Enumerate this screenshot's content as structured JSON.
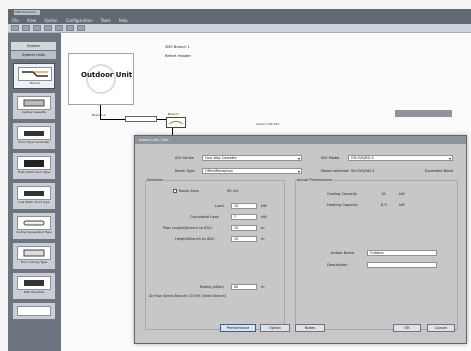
{
  "window": {
    "title": "SMS Selection"
  },
  "menu": [
    "File",
    "View",
    "Option",
    "Configuration",
    "Tools",
    "Help"
  ],
  "sidebar": {
    "header": "System",
    "header2": "System Units",
    "items": [
      {
        "label": "Branch"
      },
      {
        "label": "Ceiling Cassette"
      },
      {
        "label": "Floor Type Controller"
      },
      {
        "label": "High Static Duct Type"
      },
      {
        "label": "Low Static Duct Type"
      },
      {
        "label": "Ceiling Suspended Type"
      },
      {
        "label": "Floor Ceiling Type"
      },
      {
        "label": "Wall Mounted"
      }
    ]
  },
  "canvas": {
    "outdoor_unit": "Outdoor Unit",
    "top_label": "SMS Branch 1",
    "top_label2": "Refnet Header",
    "branch_a": "Branch A",
    "branch_b": "Branch",
    "note": "Indoor Unit Info"
  },
  "dialog": {
    "title": "Indoor Unit / Info",
    "idu_series_label": "IDU Series",
    "idu_series_value": "Four Way Cassette",
    "idu_model_label": "IDU Model",
    "idu_model_value": "GH-0VS/RD-3",
    "room_type_label": "Room Type",
    "room_type_value": "Office/Reception",
    "model_selected_label": "Model selected: GH-0VS/RD-3",
    "selected_check": "Exceeded Need",
    "selection_group": "Selection",
    "room_area_label": "Room Area",
    "room_area_value": "90 m2",
    "load_label": "Load",
    "load_value": "10",
    "load_unit": "kW",
    "calc_load_label": "Calculated Load",
    "calc_load_value": "7",
    "calc_load_unit": "kW",
    "pipe_length_label": "Pipe Length(Branch to IDU)",
    "pipe_length_value": "10",
    "pipe_length_unit": "m",
    "height_label": "Height(Branch to IDU)",
    "height_value": "10",
    "height_unit": "m",
    "actual_perf_group": "Actual Performance",
    "cooling_label": "Cooling Capacity",
    "cooling_value": "16",
    "cooling_unit": "kW",
    "heating_label": "Heating Capacity",
    "heating_value": "8.9",
    "heating_unit": "kW",
    "rating_label": "Rating (kBtu)",
    "rating_value": "60",
    "rating_unit": "m",
    "airflow_label": "Air Flow (Select Branch): (0.5/H) (Select Branch)",
    "indoor_name_label": "Indoor Name",
    "indoor_name_value": "Outdoor",
    "description_label": "Description",
    "description_value": "",
    "buttons": {
      "b1": "Performance",
      "b2": "Option",
      "b3": "Notes",
      "ok": "OK",
      "cancel": "Cancel"
    }
  },
  "colors": {
    "titlebar": "#5f6873",
    "sidebar": "#6c7580",
    "dialog": "#c7c7c7",
    "accent": "#2d5fa8"
  }
}
